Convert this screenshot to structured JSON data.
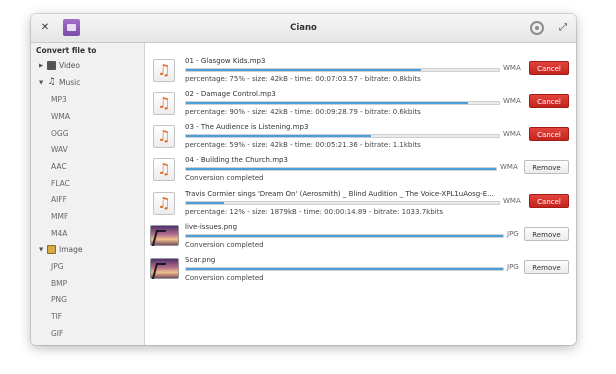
{
  "window": {
    "title": "Ciano"
  },
  "titlebar": {
    "close_icon": "close-icon",
    "folder_icon": "folder-icon",
    "gear_icon": "gear-icon",
    "maximize_icon": "maximize-icon"
  },
  "sidebar": {
    "header": "Convert file to",
    "video": "Video",
    "music": "Music",
    "music_formats": [
      "MP3",
      "WMA",
      "OGG",
      "WAV",
      "AAC",
      "FLAC",
      "AIFF",
      "MMF",
      "M4A"
    ],
    "image": "Image",
    "image_formats": [
      "JPG",
      "BMP",
      "PNG",
      "TIF",
      "GIF"
    ]
  },
  "items": [
    {
      "name": "01 - Glasgow Kids.mp3",
      "status": "percentage: 75% - size: 42kB - time: 00:07:03.57 - bitrate: 0.8kbits",
      "format": "WMA",
      "button": "Cancel",
      "progress": 75
    },
    {
      "name": "02 - Damage Control.mp3",
      "status": "percentage: 90% - size: 42kB - time: 00:09:28.79 - bitrate: 0.6kbits",
      "format": "WMA",
      "button": "Cancel",
      "progress": 90
    },
    {
      "name": "03 - The Audience is Listening.mp3",
      "status": "percentage: 59% - size: 42kB - time: 00:05:21.36 - bitrate: 1.1kbits",
      "format": "WMA",
      "button": "Cancel",
      "progress": 59
    },
    {
      "name": "04 - Building the Church.mp3",
      "status": "Conversion completed",
      "format": "WMA",
      "button": "Remove",
      "progress": 100
    },
    {
      "name": "Travis Cormier sings 'Dream On' (Aerosmith) _ Blind Audition _ The Voice-XPL1uAosg-E...",
      "status": "percentage: 12% - size: 1879kB - time: 00:00:14.89 - bitrate: 1033.7kbits",
      "format": "WMA",
      "button": "Cancel",
      "progress": 12
    },
    {
      "name": "live-issues.png",
      "status": "Conversion completed",
      "format": "JPG",
      "button": "Remove",
      "progress": 100
    },
    {
      "name": "Scar.png",
      "status": "Conversion completed",
      "format": "JPG",
      "button": "Remove",
      "progress": 100
    }
  ]
}
